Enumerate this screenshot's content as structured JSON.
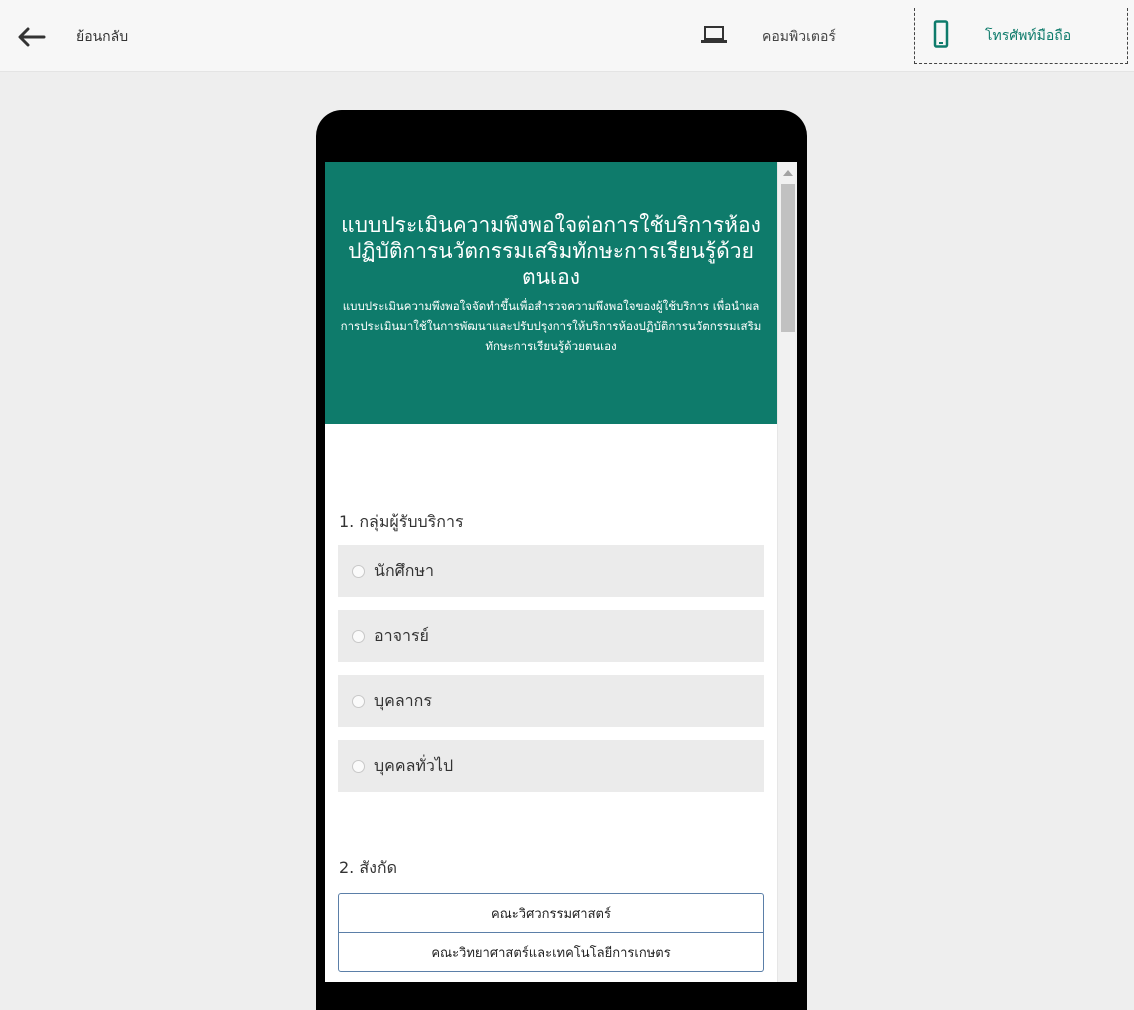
{
  "toolbar": {
    "back_label": "ย้อนกลับ",
    "computer_label": "คอมพิวเตอร์",
    "phone_label": "โทรศัพท์มือถือ",
    "back_icon": "arrow-left-icon",
    "computer_icon": "laptop-icon",
    "phone_icon": "smartphone-icon",
    "accent_color": "#0e7b6b"
  },
  "form": {
    "title": "แบบประเมินความพึงพอใจต่อการใช้บริการห้องปฏิบัติการนวัตกรรมเสริมทักษะการเรียนรู้ด้วยตนเอง",
    "description": "แบบประเมินความพึงพอใจจัดทำขึ้นเพื่อสำรวจความพึงพอใจของผู้ใช้บริการ เพื่อนำผลการประเมินมาใช้ในการพัฒนาและปรับปรุงการให้บริการห้องปฏิบัติการนวัตกรรมเสริมทักษะการเรียนรู้ด้วยตนเอง",
    "header_color": "#0e7b6b",
    "questions": [
      {
        "label": "1. กลุ่มผู้รับบริการ",
        "options": [
          "นักศึกษา",
          "อาจารย์",
          "บุคลากร",
          "บุคคลทั่วไป"
        ]
      },
      {
        "label": "2. สังกัด",
        "options": [
          "คณะวิศวกรรมศาสตร์",
          "คณะวิทยาศาสตร์และเทคโนโลยีการเกษตร"
        ]
      }
    ]
  }
}
